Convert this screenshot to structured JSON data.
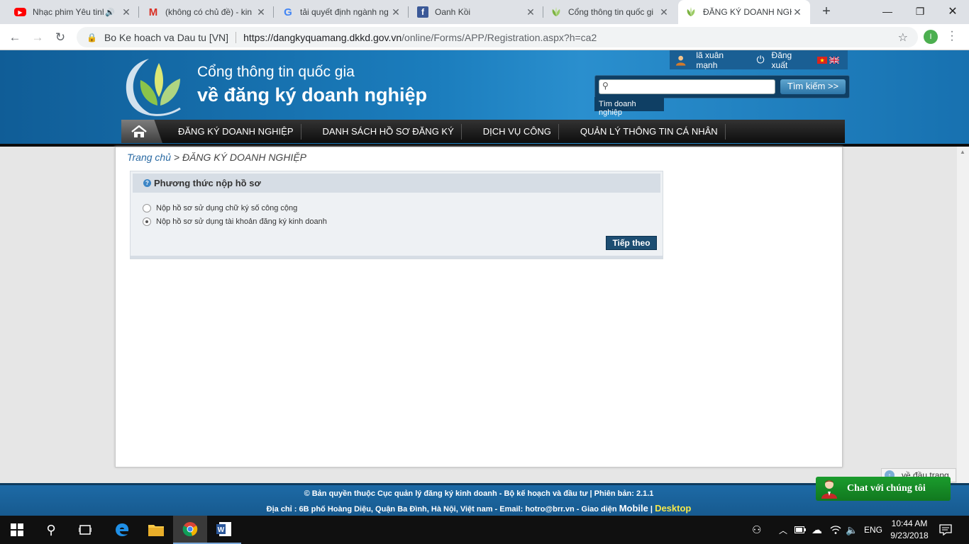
{
  "browser": {
    "tabs": [
      {
        "title": "Nhạc phim Yêu tinh",
        "icon": "youtube-icon"
      },
      {
        "title": "(không có chủ đề) - kin",
        "icon": "gmail-icon"
      },
      {
        "title": "tải quyết định ngành ng",
        "icon": "google-icon"
      },
      {
        "title": "Oanh Kồi",
        "icon": "facebook-icon"
      },
      {
        "title": "Cổng thông tin quốc gi",
        "icon": "portal-logo-icon"
      },
      {
        "title": "ĐĂNG KÝ DOANH NGH",
        "icon": "portal-logo-icon"
      }
    ],
    "address": {
      "site_name": "Bo Ke hoach va Dau tu [VN]",
      "url_host": "https://dangkyquamang.dkkd.gov.vn",
      "url_path": "/online/Forms/APP/Registration.aspx?h=ca2"
    },
    "profile_initial": "I"
  },
  "header": {
    "brand_line1": "Cổng thông tin quốc gia",
    "brand_line2": "về đăng ký doanh nghiệp",
    "user_name": "lã xuân mạnh",
    "logout_label": "Đăng xuất",
    "search_button": "Tìm kiếm >>",
    "search_hint": "Tìm doanh nghiệp",
    "search_value": ""
  },
  "nav": {
    "items": [
      "ĐĂNG KÝ DOANH NGHIỆP",
      "DANH SÁCH HỒ SƠ ĐĂNG KÝ",
      "DỊCH VỤ CÔNG",
      "QUẢN LÝ THÔNG TIN CÁ NHÂN"
    ]
  },
  "breadcrumb": {
    "home": "Trang chủ",
    "separator": " > ",
    "current": "ĐĂNG KÝ DOANH NGHIỆP"
  },
  "panel": {
    "title": "Phương thức nộp hồ sơ",
    "options": [
      {
        "label": "Nộp hồ sơ sử dụng chữ ký số công cộng",
        "checked": false
      },
      {
        "label": "Nộp hồ sơ sử dụng tài khoản đăng ký kinh doanh",
        "checked": true
      }
    ],
    "next_button": "Tiếp theo"
  },
  "footer": {
    "line1": "© Bản quyền thuộc Cục quản lý đăng ký kinh doanh - Bộ kế hoạch và đầu tư | Phiên bản: 2.1.1",
    "line2_prefix": "Địa chỉ : 6B phố Hoàng Diệu, Quận Ba Đình, Hà Nội, Việt nam - Email: ",
    "email": "hotro@brr.vn",
    "line2_mid": " - Giao diện ",
    "mobile": "Mobile",
    "pipe": " | ",
    "desktop": "Desktop"
  },
  "widgets": {
    "back_to_top": "về đầu trang",
    "chat": "Chat với chúng tôi"
  },
  "taskbar": {
    "language": "ENG",
    "time": "10:44 AM",
    "date": "9/23/2018"
  },
  "colors": {
    "header_blue": "#1b7dbd",
    "nav_black": "#0d0d0d",
    "next_button": "#1d4e72",
    "chat_green": "#1b9c2d",
    "desktop_link": "#f7e94a"
  }
}
